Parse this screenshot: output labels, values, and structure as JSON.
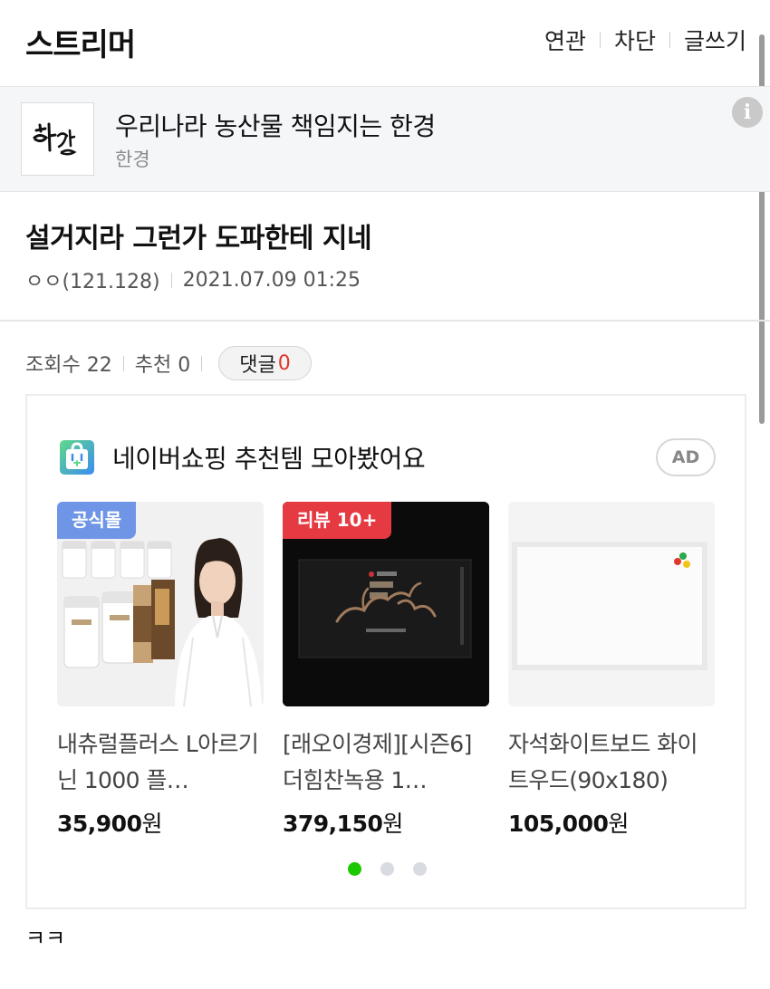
{
  "header": {
    "board_title": "스트리머",
    "nav": [
      "연관",
      "차단",
      "글쓰기"
    ]
  },
  "sponsor": {
    "logo_text": "한경",
    "title": "우리나라 농산물 책임지는 한경",
    "subtitle": "한경",
    "info_icon": "i"
  },
  "post": {
    "title": "설거지라 그런가 도파한테 지네",
    "author": "ㅇㅇ(121.128)",
    "datetime": "2021.07.09 01:25",
    "views_label": "조회수 22",
    "recommend_label": "추천 0",
    "comment_label": "댓글",
    "comment_count": "0",
    "body": "ㅋㅋ"
  },
  "ad": {
    "title": "네이버쇼핑 추천템 모아봤어요",
    "badge": "AD",
    "products": [
      {
        "badge": "공식몰",
        "name": "내츄럴플러스 L아르기닌 1000 플…",
        "price": "35,900",
        "currency": "원"
      },
      {
        "badge": "리뷰 10+",
        "name": "[래오이경제][시즌6] 더힘찬녹용 1…",
        "price": "379,150",
        "currency": "원"
      },
      {
        "badge": "",
        "name": "자석화이트보드 화이트우드(90x180)",
        "price": "105,000",
        "currency": "원"
      }
    ],
    "carousel_pages": 3,
    "carousel_active": 1
  },
  "colors": {
    "accent_green": "#1ec800",
    "comment_red": "#e0362c",
    "badge_blue": "#6f95e6",
    "badge_red": "#e63a43"
  }
}
